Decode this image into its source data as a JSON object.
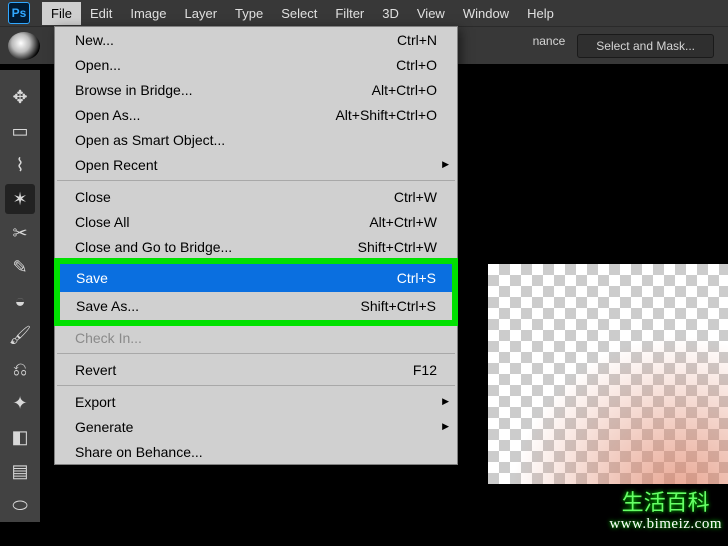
{
  "app": {
    "logo": "Ps"
  },
  "menu": {
    "items": [
      "File",
      "Edit",
      "Image",
      "Layer",
      "Type",
      "Select",
      "Filter",
      "3D",
      "View",
      "Window",
      "Help"
    ],
    "active_index": 0
  },
  "options": {
    "luminance_label": "nance",
    "select_mask_label": "Select and Mask..."
  },
  "tools": [
    {
      "name": "move-tool",
      "glyph": "✥"
    },
    {
      "name": "marquee-tool",
      "glyph": "▭"
    },
    {
      "name": "lasso-tool",
      "glyph": "⌇"
    },
    {
      "name": "quick-select-tool",
      "glyph": "✶",
      "selected": true
    },
    {
      "name": "crop-tool",
      "glyph": "✂"
    },
    {
      "name": "eyedropper-tool",
      "glyph": "✎"
    },
    {
      "name": "healing-brush-tool",
      "glyph": "◒"
    },
    {
      "name": "brush-tool",
      "glyph": "🖌"
    },
    {
      "name": "clone-stamp-tool",
      "glyph": "⎌"
    },
    {
      "name": "history-brush-tool",
      "glyph": "✦"
    },
    {
      "name": "eraser-tool",
      "glyph": "◧"
    },
    {
      "name": "gradient-tool",
      "glyph": "▤"
    },
    {
      "name": "blur-tool",
      "glyph": "⬭"
    }
  ],
  "dropdown": {
    "groups": [
      [
        {
          "label": "New...",
          "shortcut": "Ctrl+N"
        },
        {
          "label": "Open...",
          "shortcut": "Ctrl+O"
        },
        {
          "label": "Browse in Bridge...",
          "shortcut": "Alt+Ctrl+O"
        },
        {
          "label": "Open As...",
          "shortcut": "Alt+Shift+Ctrl+O"
        },
        {
          "label": "Open as Smart Object..."
        },
        {
          "label": "Open Recent",
          "submenu": true
        }
      ],
      [
        {
          "label": "Close",
          "shortcut": "Ctrl+W"
        },
        {
          "label": "Close All",
          "shortcut": "Alt+Ctrl+W"
        },
        {
          "label": "Close and Go to Bridge...",
          "shortcut": "Shift+Ctrl+W"
        }
      ],
      [
        {
          "label": "Save",
          "shortcut": "Ctrl+S",
          "highlight": "selected"
        },
        {
          "label": "Save As...",
          "shortcut": "Shift+Ctrl+S"
        }
      ],
      [
        {
          "label": "Check In...",
          "disabled": true
        }
      ],
      [
        {
          "label": "Revert",
          "shortcut": "F12"
        }
      ],
      [
        {
          "label": "Export",
          "submenu": true
        },
        {
          "label": "Generate",
          "submenu": true
        },
        {
          "label": "Share on Behance..."
        }
      ]
    ],
    "highlight_group_index": 2
  },
  "watermark": {
    "text": "生活百科",
    "url": "www.bimeiz.com"
  }
}
